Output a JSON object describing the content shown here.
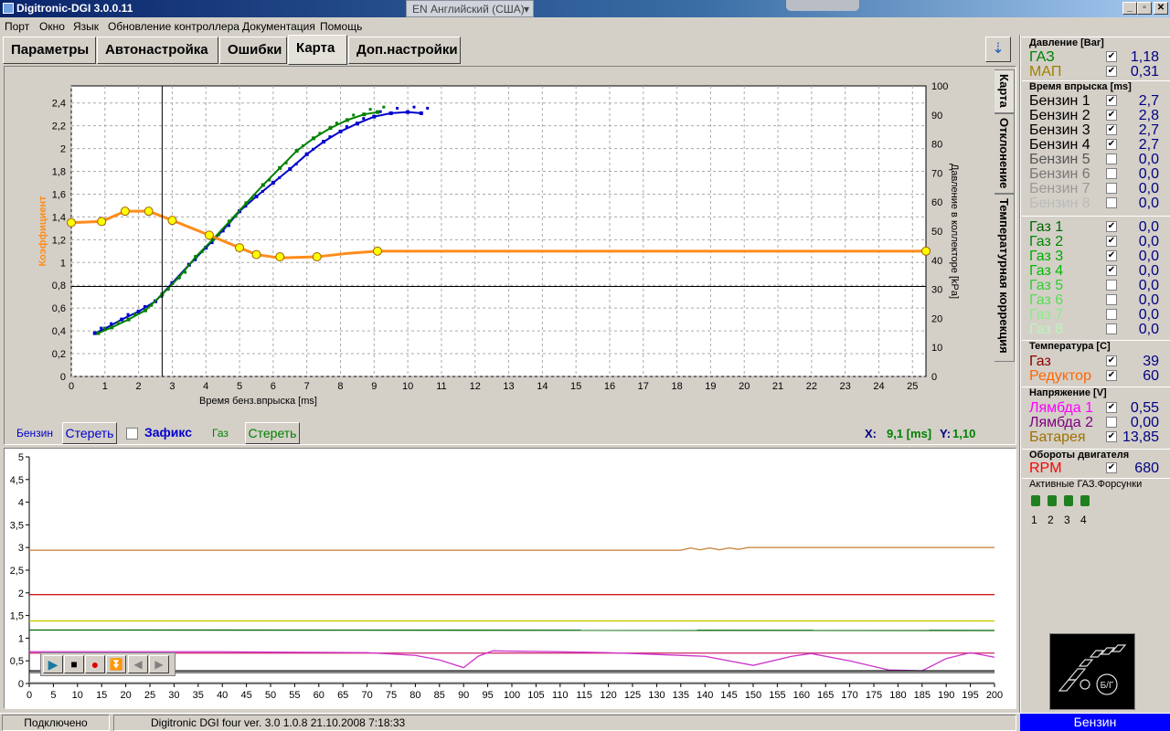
{
  "window": {
    "title": "Digitronic-DGI  3.0.0.11",
    "language": "EN Английский (США)",
    "btn_min": "_",
    "btn_max": "▫",
    "btn_close": "✕"
  },
  "menu": [
    "Порт",
    "Окно",
    "Язык",
    "Обновление контроллера",
    "Документация",
    "Помощь"
  ],
  "tabs": [
    "Параметры",
    "Автонастройка",
    "Ошибки",
    "Карта",
    "Доп.настройки"
  ],
  "active_tab": "Карта",
  "side_tabs": [
    "Карта",
    "Отклонение",
    "Температурная коррекция"
  ],
  "map_chart": {
    "type": "scatter",
    "xlabel": "Время бенз.впрыска [ms]",
    "ylabel_left": "Коэффициент",
    "ylabel_right": "Давление в коллекторе [kPa]",
    "xticks": [
      "0",
      "1",
      "2",
      "3",
      "4",
      "5",
      "6",
      "7",
      "8",
      "9",
      "10",
      "11",
      "12",
      "13",
      "14",
      "15",
      "16",
      "17",
      "18",
      "19",
      "20",
      "21",
      "22",
      "23",
      "24",
      "25"
    ],
    "yticks_left": [
      "2,4",
      "2,2",
      "2",
      "1,8",
      "1,6",
      "1,4",
      "1,2",
      "1",
      "0,8",
      "0,6",
      "0,4",
      "0,2",
      "0"
    ],
    "yticks_right": [
      "100",
      "90",
      "80",
      "70",
      "60",
      "50",
      "40",
      "30",
      "20",
      "10",
      "0"
    ],
    "xlim": [
      0,
      25.4
    ],
    "ylim_left": [
      0,
      2.55
    ],
    "ylim_right": [
      0,
      100
    ],
    "cursor": {
      "x": 2.7,
      "y": 0.79
    },
    "coefficient_points": [
      [
        0,
        1.35
      ],
      [
        0.9,
        1.36
      ],
      [
        1.6,
        1.45
      ],
      [
        2.3,
        1.45
      ],
      [
        3,
        1.37
      ],
      [
        4.1,
        1.24
      ],
      [
        5,
        1.13
      ],
      [
        5.5,
        1.07
      ],
      [
        6.2,
        1.05
      ],
      [
        7.3,
        1.05
      ],
      [
        9.1,
        1.1
      ],
      [
        25.4,
        1.1
      ]
    ],
    "coefficient_line": [
      [
        0,
        1.35
      ],
      [
        0.9,
        1.36
      ],
      [
        1.6,
        1.45
      ],
      [
        2.3,
        1.45
      ],
      [
        3,
        1.37
      ],
      [
        4.1,
        1.24
      ],
      [
        5,
        1.13
      ],
      [
        5.5,
        1.07
      ],
      [
        6.2,
        1.04
      ],
      [
        7.3,
        1.05
      ],
      [
        8.2,
        1.08
      ],
      [
        9.1,
        1.1
      ],
      [
        25.4,
        1.1
      ]
    ],
    "series": [
      {
        "name": "Бензин",
        "color": "#0000cc",
        "points": [
          [
            0.7,
            0.38
          ],
          [
            1,
            0.42
          ],
          [
            1.5,
            0.5
          ],
          [
            2,
            0.57
          ],
          [
            2.5,
            0.66
          ],
          [
            3,
            0.82
          ],
          [
            3.5,
            0.98
          ],
          [
            4,
            1.13
          ],
          [
            4.5,
            1.28
          ],
          [
            5,
            1.45
          ],
          [
            5.5,
            1.58
          ],
          [
            6,
            1.7
          ],
          [
            6.5,
            1.82
          ],
          [
            7,
            1.95
          ],
          [
            7.5,
            2.06
          ],
          [
            8,
            2.15
          ],
          [
            8.5,
            2.22
          ],
          [
            9,
            2.28
          ],
          [
            9.5,
            2.31
          ],
          [
            10,
            2.32
          ],
          [
            10.4,
            2.31
          ]
        ]
      },
      {
        "name": "Газ",
        "color": "#008000",
        "points": [
          [
            0.8,
            0.38
          ],
          [
            1.2,
            0.43
          ],
          [
            1.7,
            0.5
          ],
          [
            2.2,
            0.58
          ],
          [
            2.7,
            0.72
          ],
          [
            3.2,
            0.87
          ],
          [
            3.7,
            1.05
          ],
          [
            4.2,
            1.2
          ],
          [
            4.7,
            1.36
          ],
          [
            5.2,
            1.52
          ],
          [
            5.7,
            1.68
          ],
          [
            6.2,
            1.83
          ],
          [
            6.7,
            1.98
          ],
          [
            7.2,
            2.09
          ],
          [
            7.7,
            2.18
          ],
          [
            8.2,
            2.25
          ],
          [
            8.7,
            2.3
          ],
          [
            9.1,
            2.32
          ]
        ]
      }
    ]
  },
  "controls": {
    "benzin_label": "Бензин",
    "benzin_clear": "Стереть",
    "fix_label": "Зафикс",
    "gas_label": "Газ",
    "gas_clear": "Стереть",
    "coord_x_label": "X:",
    "coord_x_value": "9,1 [ms]",
    "coord_y_label": "Y:",
    "coord_y_value": "1,10"
  },
  "trend_chart": {
    "type": "line",
    "xticks": [
      "0",
      "5",
      "10",
      "15",
      "20",
      "25",
      "30",
      "35",
      "40",
      "45",
      "50",
      "55",
      "60",
      "65",
      "70",
      "75",
      "80",
      "85",
      "90",
      "95",
      "100",
      "105",
      "110",
      "115",
      "120",
      "125",
      "130",
      "135",
      "140",
      "145",
      "150",
      "155",
      "160",
      "165",
      "170",
      "175",
      "180",
      "185",
      "190",
      "195",
      "200"
    ],
    "yticks": [
      "5",
      "4,5",
      "4",
      "3,5",
      "3",
      "2,5",
      "2",
      "1,5",
      "1",
      "0,5",
      "0"
    ],
    "xlim": [
      0,
      200
    ],
    "ylim": [
      0,
      5
    ],
    "series": [
      {
        "color": "#cc8844",
        "points": [
          [
            0,
            2.94
          ],
          [
            135,
            2.94
          ],
          [
            137,
            2.99
          ],
          [
            139,
            2.95
          ],
          [
            141,
            2.99
          ],
          [
            143,
            2.95
          ],
          [
            145,
            2.99
          ],
          [
            147,
            2.96
          ],
          [
            149,
            3.0
          ],
          [
            200,
            3.0
          ]
        ]
      },
      {
        "color": "#cc0000",
        "points": [
          [
            0,
            1.96
          ],
          [
            200,
            1.96
          ]
        ]
      },
      {
        "color": "#c8c800",
        "points": [
          [
            0,
            1.38
          ],
          [
            200,
            1.38
          ]
        ]
      },
      {
        "color": "#006600",
        "points": [
          [
            0,
            1.18
          ],
          [
            200,
            1.17
          ]
        ]
      },
      {
        "color": "#cc2266",
        "points": [
          [
            0,
            0.67
          ],
          [
            200,
            0.67
          ]
        ]
      },
      {
        "color": "#cc33cc",
        "points": [
          [
            0,
            0.7
          ],
          [
            40,
            0.7
          ],
          [
            70,
            0.68
          ],
          [
            80,
            0.62
          ],
          [
            85,
            0.52
          ],
          [
            90,
            0.35
          ],
          [
            93,
            0.6
          ],
          [
            96,
            0.72
          ],
          [
            110,
            0.7
          ],
          [
            120,
            0.68
          ],
          [
            140,
            0.6
          ],
          [
            150,
            0.4
          ],
          [
            158,
            0.6
          ],
          [
            162,
            0.66
          ],
          [
            170,
            0.5
          ],
          [
            178,
            0.3
          ],
          [
            185,
            0.28
          ],
          [
            190,
            0.55
          ],
          [
            195,
            0.68
          ],
          [
            200,
            0.58
          ]
        ]
      },
      {
        "color": "#000000",
        "points": [
          [
            0,
            0.28
          ],
          [
            200,
            0.28
          ]
        ]
      },
      {
        "color": "#444444",
        "points": [
          [
            0,
            0.24
          ],
          [
            200,
            0.24
          ]
        ]
      },
      {
        "color": "#aaaaaa",
        "points": [
          [
            0,
            0.02
          ],
          [
            200,
            0.02
          ]
        ]
      }
    ]
  },
  "side": {
    "pressure": {
      "header": "Давление [Bar]",
      "rows": [
        {
          "label": "ГАЗ",
          "value": "1,18",
          "checked": "✔",
          "color": "#008000"
        },
        {
          "label": "МАП",
          "value": "0,31",
          "checked": "✔",
          "color": "#a08000"
        }
      ]
    },
    "injection": {
      "header": "Время впрыска [ms]",
      "rows": [
        {
          "label": "Бензин 1",
          "value": "2,7",
          "checked": "✔",
          "color": "#000000"
        },
        {
          "label": "Бензин 2",
          "value": "2,8",
          "checked": "✔",
          "color": "#000000"
        },
        {
          "label": "Бензин 3",
          "value": "2,7",
          "checked": "✔",
          "color": "#000000"
        },
        {
          "label": "Бензин 4",
          "value": "2,7",
          "checked": "✔",
          "color": "#000000"
        },
        {
          "label": "Бензин 5",
          "value": "0,0",
          "checked": "",
          "color": "#555555"
        },
        {
          "label": "Бензин 6",
          "value": "0,0",
          "checked": "",
          "color": "#777777"
        },
        {
          "label": "Бензин 7",
          "value": "0,0",
          "checked": "",
          "color": "#999999"
        },
        {
          "label": "Бензин 8",
          "value": "0,0",
          "checked": "",
          "color": "#bbbbbb"
        }
      ]
    },
    "gas": {
      "rows": [
        {
          "label": "Газ 1",
          "value": "0,0",
          "checked": "✔",
          "color": "#006600"
        },
        {
          "label": "Газ 2",
          "value": "0,0",
          "checked": "✔",
          "color": "#008800"
        },
        {
          "label": "Газ 3",
          "value": "0,0",
          "checked": "✔",
          "color": "#00aa00"
        },
        {
          "label": "Газ 4",
          "value": "0,0",
          "checked": "✔",
          "color": "#00bb00"
        },
        {
          "label": "Газ 5",
          "value": "0,0",
          "checked": "",
          "color": "#33cc33"
        },
        {
          "label": "Газ 6",
          "value": "0,0",
          "checked": "",
          "color": "#55dd55"
        },
        {
          "label": "Газ 7",
          "value": "0,0",
          "checked": "",
          "color": "#88ee88"
        },
        {
          "label": "Газ 8",
          "value": "0,0",
          "checked": "",
          "color": "#bbf5bb"
        }
      ]
    },
    "temperature": {
      "header": "Температура  [C]",
      "rows": [
        {
          "label": "Газ",
          "value": "39",
          "checked": "✔",
          "color": "#8b0000"
        },
        {
          "label": "Редуктор",
          "value": "60",
          "checked": "✔",
          "color": "#ff6600"
        }
      ]
    },
    "voltage": {
      "header": "Напряжение [V]",
      "rows": [
        {
          "label": "Лямбда 1",
          "value": "0,55",
          "checked": "✔",
          "color": "#ff00ff"
        },
        {
          "label": "Лямбда 2",
          "value": "0,00",
          "checked": "",
          "color": "#800080"
        },
        {
          "label": "Батарея",
          "value": "13,85",
          "checked": "✔",
          "color": "#a07000"
        }
      ]
    },
    "rpm": {
      "header": "Обороты двигателя",
      "rows": [
        {
          "label": "RPM",
          "value": "680",
          "checked": "✔",
          "color": "#ff0000"
        }
      ]
    },
    "injectors": {
      "header": "Активные ГАЗ.Форсунки",
      "numbers": [
        "1",
        "2",
        "3",
        "4"
      ]
    },
    "fuel_switch": {
      "label": "Б/Г",
      "mode": "Бензин"
    }
  },
  "status": {
    "connection": "Подключено",
    "info": "Digitronic DGI four   ver. 3.0  1.0.8    21.10.2008 7:18:33"
  },
  "colors": {
    "coefficient": "#ff8c1a",
    "benzin": "#0000cc",
    "gas": "#008000",
    "mode_bar": "#0000ff"
  }
}
